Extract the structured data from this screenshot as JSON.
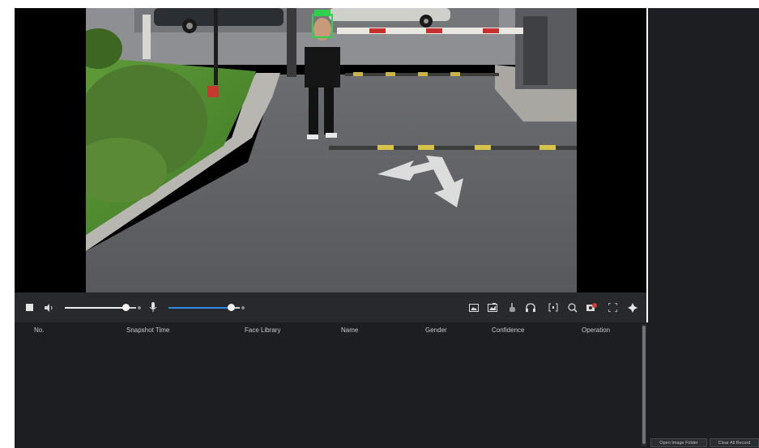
{
  "toolbar": {
    "left_icons": [
      "stop-icon",
      "speaker-icon",
      "microphone-icon"
    ],
    "right_icons": [
      "snapshot-icon",
      "record-icon",
      "hand-icon",
      "headset-icon",
      "crop-icon",
      "zoom-icon",
      "fisheye-icon",
      "fullscreen-icon",
      "ptz-icon"
    ],
    "volume_level": 0.85,
    "mic_level": 0.88,
    "mic_fill_color": "#2e8ae6"
  },
  "table": {
    "columns": [
      "No.",
      "Snapshot Time",
      "Face Library",
      "Name",
      "Gender",
      "Confidence",
      "Operation"
    ],
    "rows": []
  },
  "panel": {
    "open_folder_label": "Open Image Folder",
    "clear_label": "Clear All Record"
  },
  "colors": {
    "face_box": "#2fd14b",
    "video_bg": "#000000",
    "toolbar_bg": "#27292c",
    "table_bg": "#1d1e21"
  }
}
